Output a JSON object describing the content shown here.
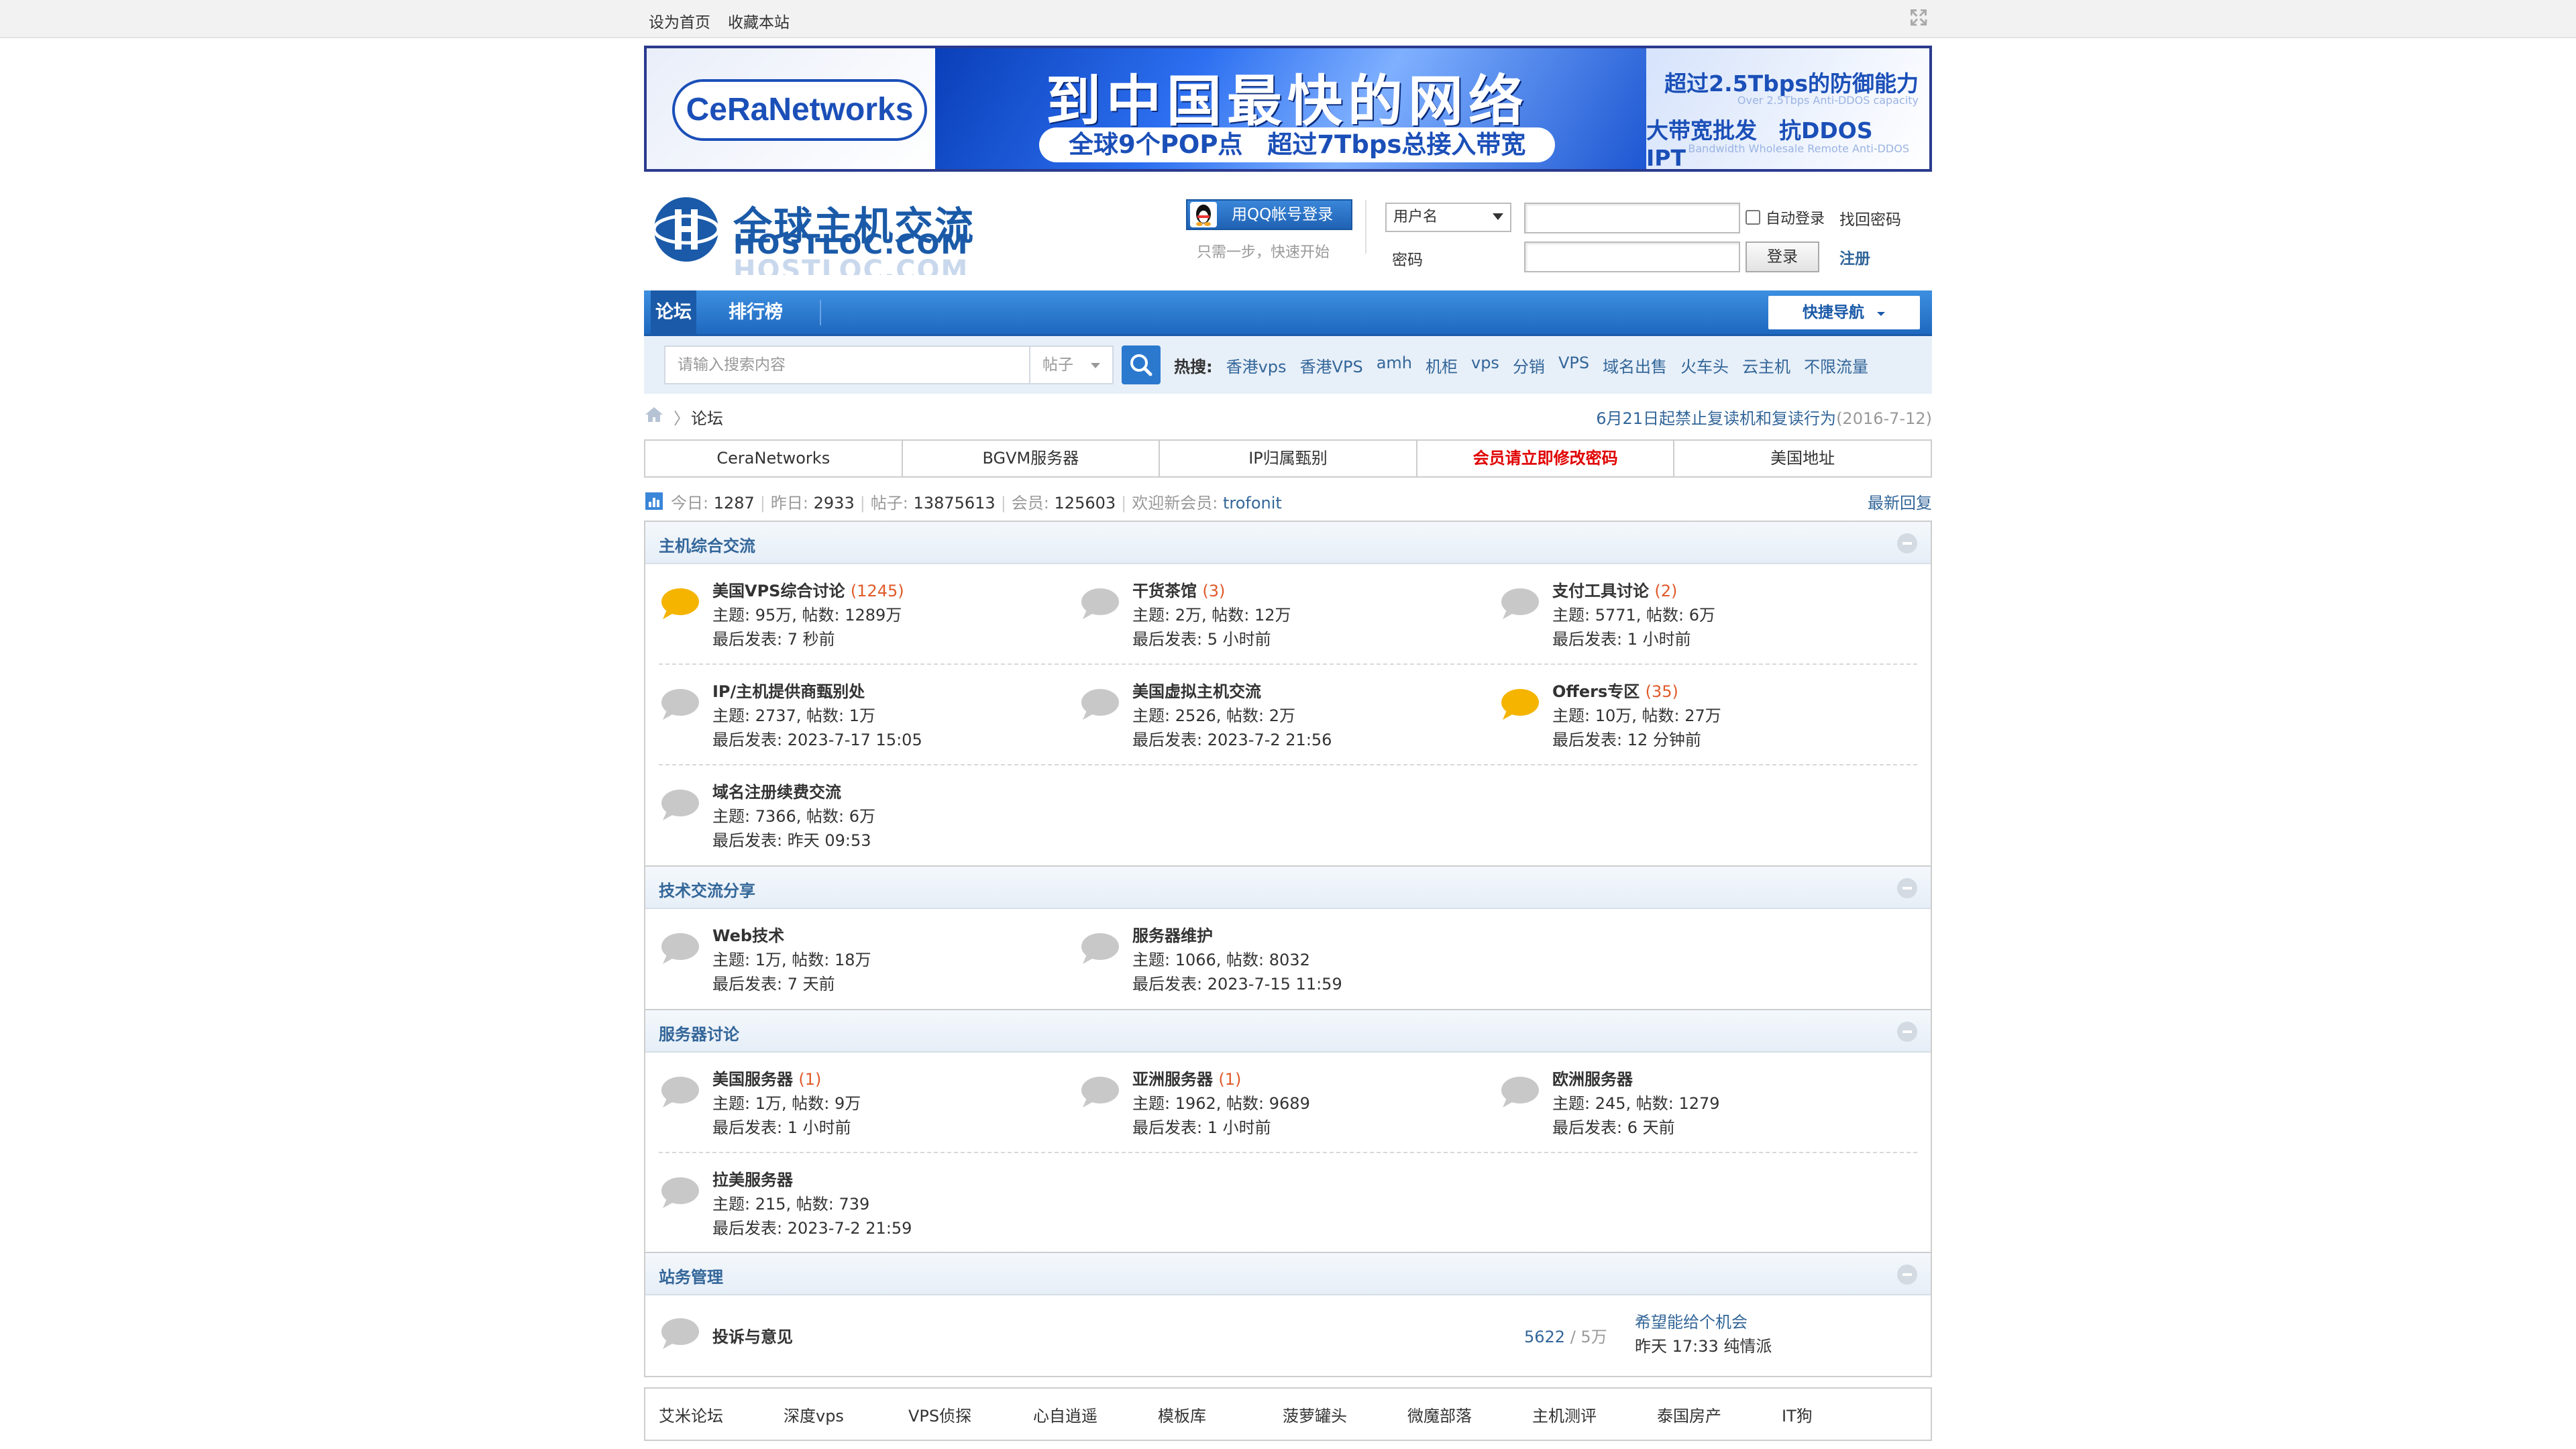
{
  "topbar": {
    "set_home": "设为首页",
    "bookmark": "收藏本站"
  },
  "banner": {
    "brand": "CeRaNetworks",
    "headline": "到中国最快的网络",
    "sub": "全球9个POP点　超过7Tbps总接入带宽",
    "right1": "超过2.5Tbps的防御能力",
    "right1_sub": "Over 2.5Tbps Anti-DDOS capacity",
    "right2": "大带宽批发　抗DDOS IPT",
    "right2_sub": "Bandwidth Wholesale   Remote Anti-DDOS"
  },
  "logo": {
    "cn": "全球主机交流",
    "en": "HOSTLOC.COM"
  },
  "login": {
    "qq_button": "用QQ帐号登录",
    "qq_hint": "只需一步，快速开始",
    "username_select": "用户名",
    "password_label": "密码",
    "auto_login": "自动登录",
    "login_button": "登录",
    "forgot_password": "找回密码",
    "register": "注册"
  },
  "nav": {
    "forum": "论坛",
    "ranking": "排行榜",
    "quick_nav": "快捷导航"
  },
  "search": {
    "placeholder": "请输入搜索内容",
    "type": "帖子",
    "hot_label": "热搜:",
    "hot_terms": [
      "香港vps",
      "香港VPS",
      "amh",
      "机柜",
      "vps",
      "分销",
      "VPS",
      "域名出售",
      "火车头",
      "云主机",
      "不限流量"
    ]
  },
  "breadcrumb": {
    "current": "论坛",
    "notice": "6月21日起禁止复读机和复读行为",
    "notice_date": "(2016-7-12)"
  },
  "quicklinks": [
    "CeraNetworks",
    "BGVM服务器",
    "IP归属甄别",
    "会员请立即修改密码",
    "美国地址"
  ],
  "stats": {
    "today_label": "今日:",
    "today": "1287",
    "yesterday_label": "昨日:",
    "yesterday": "2933",
    "posts_label": "帖子:",
    "posts": "13875613",
    "members_label": "会员:",
    "members": "125603",
    "welcome_label": "欢迎新会员:",
    "new_member": "trofonit",
    "latest_reply": "最新回复"
  },
  "sections": {
    "s1": {
      "title": "主机综合交流",
      "forums": [
        {
          "name": "美国VPS综合讨论",
          "count": "(1245)",
          "meta": "主题: 95万, 帖数: 1289万",
          "last": "最后发表: 7 秒前"
        },
        {
          "name": "干货茶馆",
          "count": "(3)",
          "meta": "主题: 2万, 帖数: 12万",
          "last": "最后发表: 5 小时前"
        },
        {
          "name": "支付工具讨论",
          "count": "(2)",
          "meta": "主题: 5771, 帖数: 6万",
          "last": "最后发表: 1 小时前"
        },
        {
          "name": "IP/主机提供商甄别处",
          "count": "",
          "meta": "主题: 2737, 帖数: 1万",
          "last": "最后发表: 2023-7-17 15:05"
        },
        {
          "name": "美国虚拟主机交流",
          "count": "",
          "meta": "主题: 2526, 帖数: 2万",
          "last": "最后发表: 2023-7-2 21:56"
        },
        {
          "name": "Offers专区",
          "count": "(35)",
          "meta": "主题: 10万, 帖数: 27万",
          "last": "最后发表: 12 分钟前"
        },
        {
          "name": "域名注册续费交流",
          "count": "",
          "meta": "主题: 7366, 帖数: 6万",
          "last": "最后发表: 昨天 09:53"
        }
      ]
    },
    "s2": {
      "title": "技术交流分享",
      "forums": [
        {
          "name": "Web技术",
          "count": "",
          "meta": "主题: 1万, 帖数: 18万",
          "last": "最后发表: 7 天前"
        },
        {
          "name": "服务器维护",
          "count": "",
          "meta": "主题: 1066, 帖数: 8032",
          "last": "最后发表: 2023-7-15 11:59"
        }
      ]
    },
    "s3": {
      "title": "服务器讨论",
      "forums": [
        {
          "name": "美国服务器",
          "count": "(1)",
          "meta": "主题: 1万, 帖数: 9万",
          "last": "最后发表: 1 小时前"
        },
        {
          "name": "亚洲服务器",
          "count": "(1)",
          "meta": "主题: 1962, 帖数: 9689",
          "last": "最后发表: 1 小时前"
        },
        {
          "name": "欧洲服务器",
          "count": "",
          "meta": "主题: 245, 帖数: 1279",
          "last": "最后发表: 6 天前"
        },
        {
          "name": "拉美服务器",
          "count": "",
          "meta": "主题: 215, 帖数: 739",
          "last": "最后发表: 2023-7-2 21:59"
        }
      ]
    },
    "s4": {
      "title": "站务管理",
      "forum": {
        "name": "投诉与意见",
        "threads": "5622",
        "posts": "/ 5万",
        "last_post": "希望能给个机会",
        "last_meta": "昨天 17:33 纯情派"
      }
    }
  },
  "friend_links": [
    "艾米论坛",
    "深度vps",
    "VPS侦探",
    "心自逍遥",
    "模板库",
    "菠萝罐头",
    "微魔部落",
    "主机测评",
    "泰国房产",
    "IT狗"
  ],
  "colors": {
    "primary_blue": "#1e68bf",
    "link": "#336699",
    "count_orange": "#e05a2a",
    "alert_red": "#e00000",
    "bubble_active": "#f4b400",
    "bubble_idle": "#c8c8c8"
  }
}
